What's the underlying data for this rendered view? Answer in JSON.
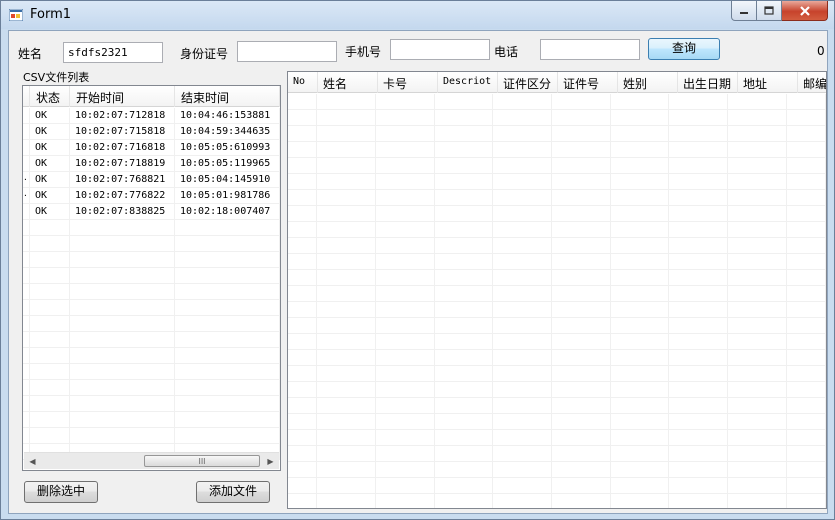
{
  "window": {
    "title": "Form1"
  },
  "form": {
    "name_label": "姓名",
    "name_value": "sfdfs2321",
    "id_label": "身份证号",
    "id_value": "",
    "mobile_label": "手机号",
    "mobile_value": "",
    "phone_label": "电话",
    "phone_value": "",
    "search_button": "查询",
    "result_count": "0"
  },
  "csv_panel": {
    "title": "CSV文件列表",
    "columns": [
      "状态",
      "开始时间",
      "结束时间"
    ],
    "rows": [
      {
        "status": "OK",
        "start": "10:02:07:712818",
        "end": "10:04:46:153881",
        "marker": ""
      },
      {
        "status": "OK",
        "start": "10:02:07:715818",
        "end": "10:04:59:344635",
        "marker": ""
      },
      {
        "status": "OK",
        "start": "10:02:07:716818",
        "end": "10:05:05:610993",
        "marker": ""
      },
      {
        "status": "OK",
        "start": "10:02:07:718819",
        "end": "10:05:05:119965",
        "marker": ""
      },
      {
        "status": "OK",
        "start": "10:02:07:768821",
        "end": "10:05:04:145910",
        "marker": "·"
      },
      {
        "status": "OK",
        "start": "10:02:07:776822",
        "end": "10:05:01:981786",
        "marker": "·"
      },
      {
        "status": "OK",
        "start": "10:02:07:838825",
        "end": "10:02:18:007407",
        "marker": ""
      }
    ],
    "scroll_thumb_glyph": "III",
    "delete_button": "删除选中",
    "add_button": "添加文件"
  },
  "results": {
    "columns": [
      "No",
      "姓名",
      "卡号",
      "Descriot",
      "证件区分",
      "证件号",
      "姓别",
      "出生日期",
      "地址",
      "邮编"
    ]
  },
  "icons": {
    "app": "form-app-icon",
    "minimize": "minimize-icon",
    "maximize": "maximize-icon",
    "close": "close-icon"
  },
  "colors": {
    "titlebar": "#c4d8ee",
    "close_button": "#c7432c",
    "client_bg": "#f0f0f0"
  }
}
